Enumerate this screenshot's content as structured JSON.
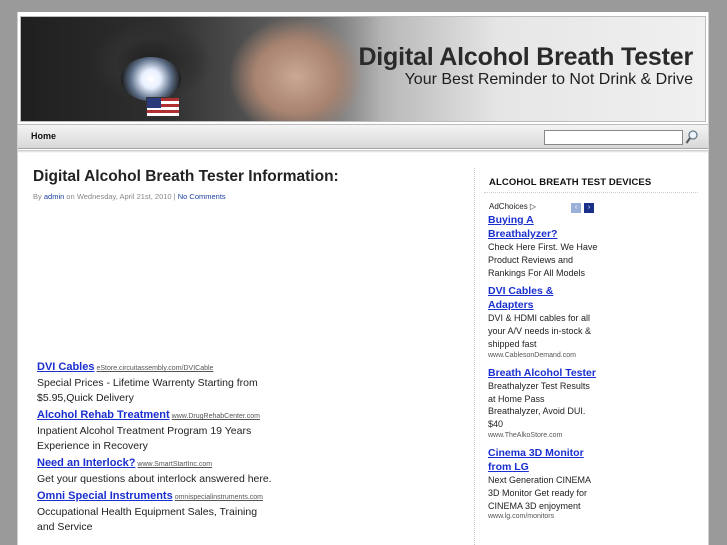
{
  "header": {
    "title": "Digital Alcohol Breath Tester",
    "tagline": "Your Best Reminder to Not Drink & Drive"
  },
  "nav": {
    "home_label": "Home",
    "search_value": ""
  },
  "post": {
    "title": "Digital Alcohol Breath Tester Information:",
    "meta_by": "By",
    "author": "admin",
    "meta_date": "on Wednesday, April 21st, 2010 |",
    "comments": "No Comments"
  },
  "content_ads": [
    {
      "title": "DVI Cables",
      "url": "eStore.circuitassembly.com/DVICable",
      "desc": "Special Prices - Lifetime Warrenty Starting from $5.95,Quick Delivery"
    },
    {
      "title": "Alcohol Rehab Treatment",
      "url": "www.DrugRehabCenter.com",
      "desc": "Inpatient Alcohol Treatment Program 19 Years Experience in Recovery"
    },
    {
      "title": "Need an Interlock?",
      "url": "www.SmartStartInc.com",
      "desc": "Get your questions about interlock answered here."
    },
    {
      "title": "Omni Special Instruments",
      "url": "omnispecialinstruments.com",
      "desc": "Occupational Health Equipment Sales, Training and Service"
    }
  ],
  "sidebar": {
    "title": "ALCOHOL BREATH TEST DEVICES",
    "adchoices": "AdChoices ▷",
    "prev": "‹",
    "next": "›",
    "ads": [
      {
        "title": "Buying A Breathalyzer?",
        "desc": "Check Here First. We Have Product Reviews and Rankings For All Models",
        "url": ""
      },
      {
        "title": "DVI Cables & Adapters",
        "desc": "DVI & HDMI cables for all your A/V needs in-stock & shipped fast",
        "url": "www.CablesonDemand.com"
      },
      {
        "title": "Breath Alcohol Tester",
        "desc": "Breathalyzer Test Results at Home Pass Breathalyzer, Avoid DUI. $40",
        "url": "www.TheAlkoStore.com"
      },
      {
        "title": "Cinema 3D Monitor from LG",
        "desc": "Next Generation CINEMA 3D Monitor Get ready for CINEMA 3D enjoyment",
        "url": "www.lg.com/monitors"
      }
    ]
  }
}
